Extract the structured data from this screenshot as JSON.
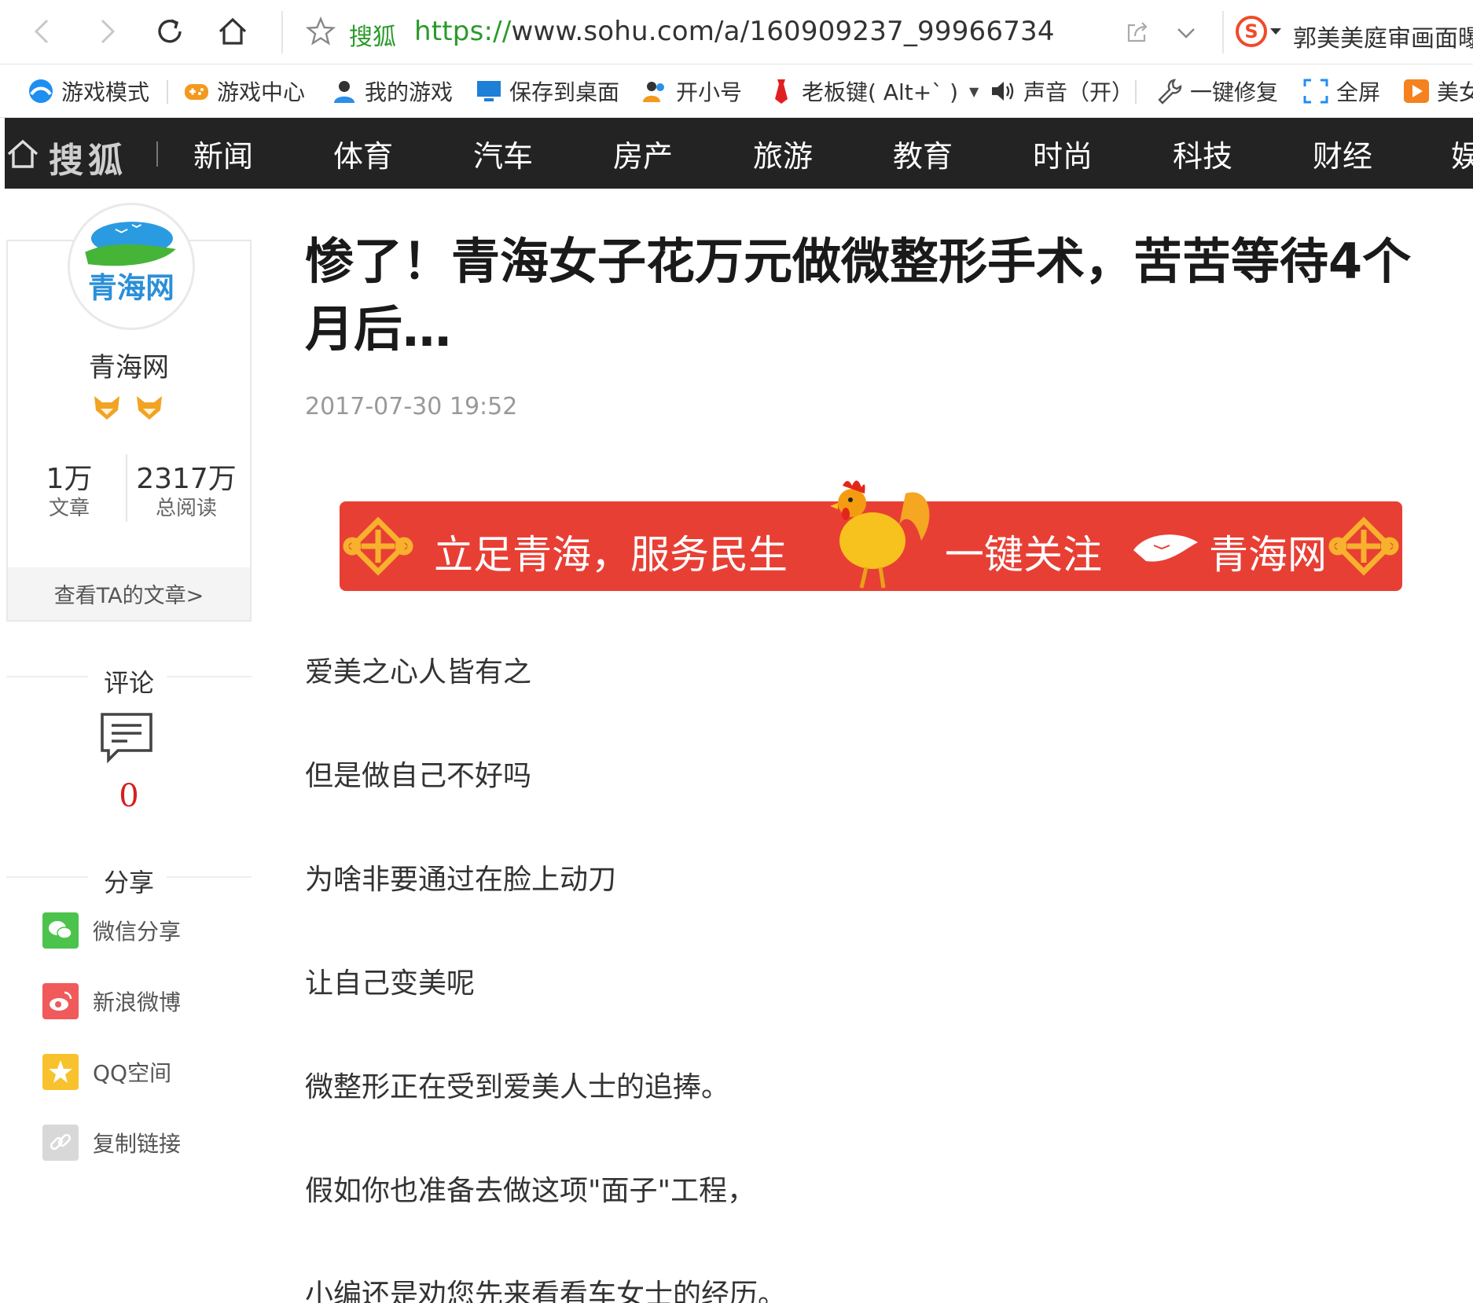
{
  "browser": {
    "site_name": "搜狐",
    "url_scheme": "https://",
    "url_rest": "www.sohu.com/a/160909237_99966734",
    "search_hint": "郭美美庭审画面曝",
    "accent_green": "#2b9a2b"
  },
  "bookmarks": [
    {
      "label": "游戏模式",
      "icon": "globe-icon"
    },
    {
      "label": "游戏中心",
      "icon": "gamepad-icon"
    },
    {
      "label": "我的游戏",
      "icon": "user-icon"
    },
    {
      "label": "保存到桌面",
      "icon": "monitor-icon"
    },
    {
      "label": "开小号",
      "icon": "users-icon"
    },
    {
      "label": "老板键( Alt+` )",
      "icon": "tie-icon"
    },
    {
      "label": "声音（开）",
      "icon": "speaker-icon"
    },
    {
      "label": "一键修复",
      "icon": "wrench-icon"
    },
    {
      "label": "全屏",
      "icon": "fullscreen-icon"
    },
    {
      "label": "美女",
      "icon": "play-icon"
    }
  ],
  "sohu_nav": {
    "logo": "搜狐",
    "links": [
      "新闻",
      "体育",
      "汽车",
      "房产",
      "旅游",
      "教育",
      "时尚",
      "科技",
      "财经",
      "娱"
    ]
  },
  "author": {
    "logo_text": "青海网",
    "name": "青海网",
    "articles_num": "1万",
    "articles_label": "文章",
    "reads_num": "2317万",
    "reads_label": "总阅读",
    "view_link": "查看TA的文章>"
  },
  "comments": {
    "title": "评论",
    "count": "0"
  },
  "share": {
    "title": "分享",
    "items": [
      {
        "label": "微信分享",
        "icon": "wechat-icon",
        "color": "#4cc34d"
      },
      {
        "label": "新浪微博",
        "icon": "weibo-icon",
        "color": "#f05a5a"
      },
      {
        "label": "QQ空间",
        "icon": "qzone-icon",
        "color": "#f7c22d"
      },
      {
        "label": "复制链接",
        "icon": "link-icon",
        "color": "#d5d5d5"
      }
    ]
  },
  "article": {
    "title": "惨了！青海女子花万元做微整形手术，苦苦等待4个月后…",
    "date": "2017-07-30 19:52",
    "banner": {
      "text1": "立足青海，服务民生",
      "text2": "一键关注",
      "text3": "青海网",
      "color": "#e83f35"
    },
    "paragraphs": [
      "爱美之心人皆有之",
      "但是做自己不好吗",
      "为啥非要通过在脸上动刀",
      "让自己变美呢",
      "微整形正在受到爱美人士的追捧。",
      "假如你也准备去做这项\"面子\"工程，",
      "小编还是劝您先来看看车女士的经历。"
    ]
  }
}
